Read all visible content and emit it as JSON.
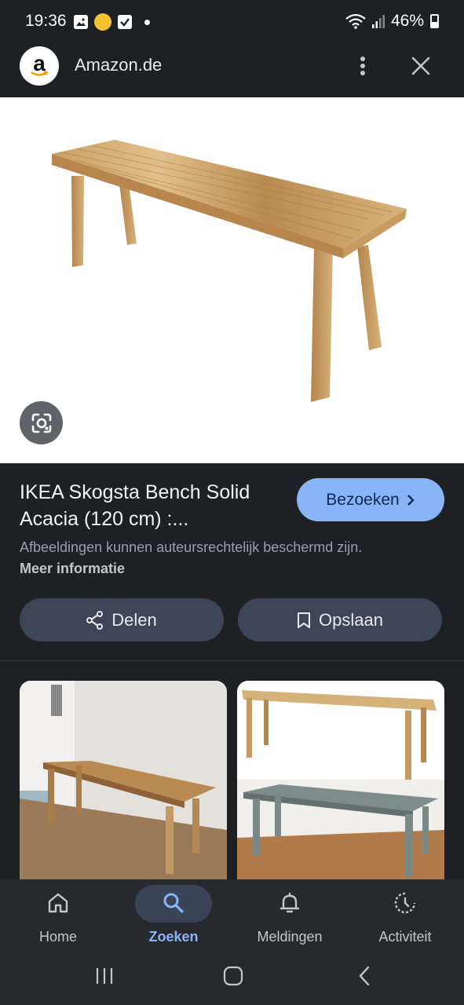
{
  "status_bar": {
    "time": "19:36",
    "battery": "46%",
    "notification_icons": [
      "image-icon",
      "app-badge-icon",
      "check-icon"
    ]
  },
  "header": {
    "site_name": "Amazon.de",
    "logo_letter": "a"
  },
  "product": {
    "title": "IKEA Skogsta Bench Solid Acacia (120 cm) :...",
    "visit_label": "Bezoeken",
    "copyright_text": "Afbeeldingen kunnen auteursrechtelijk beschermd zijn.",
    "more_info_label": "Meer informatie",
    "share_label": "Delen",
    "save_label": "Opslaan"
  },
  "bottom_nav": {
    "items": [
      {
        "label": "Home",
        "icon": "home-icon",
        "active": false
      },
      {
        "label": "Zoeken",
        "icon": "search-icon",
        "active": true
      },
      {
        "label": "Meldingen",
        "icon": "bell-icon",
        "active": false
      },
      {
        "label": "Activiteit",
        "icon": "history-icon",
        "active": false
      }
    ]
  },
  "colors": {
    "background": "#1f2024",
    "accent": "#8ab4f8",
    "button_bg": "#3c4657",
    "nav_bg": "#27292d"
  }
}
